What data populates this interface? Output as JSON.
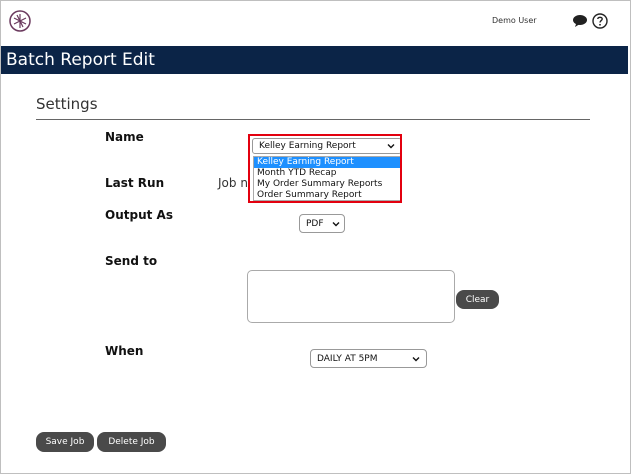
{
  "header": {
    "user": "Demo User",
    "icons": [
      "logo-icon",
      "chat-icon",
      "help-icon"
    ]
  },
  "page": {
    "title": "Batch Report Edit",
    "section": "Settings"
  },
  "form": {
    "name_label": "Name",
    "name_selected": "Kelley Earning Report",
    "name_options": [
      "Kelley Earning Report",
      "Month YTD Recap",
      "My Order Summary Reports",
      "Order Summary Report"
    ],
    "last_run_label": "Last Run",
    "last_run_value": "Job n",
    "output_label": "Output As",
    "output_value": "PDF",
    "send_to_label": "Send to",
    "send_to_value": "",
    "clear_label": "Clear",
    "when_label": "When",
    "when_value": "DAILY AT 5PM"
  },
  "footer": {
    "save_label": "Save Job",
    "delete_label": "Delete Job"
  },
  "colors": {
    "title_bar": "#0b2447",
    "highlight": "#e3000f",
    "selected_option": "#1e90ff",
    "button": "#4a4a4a"
  }
}
